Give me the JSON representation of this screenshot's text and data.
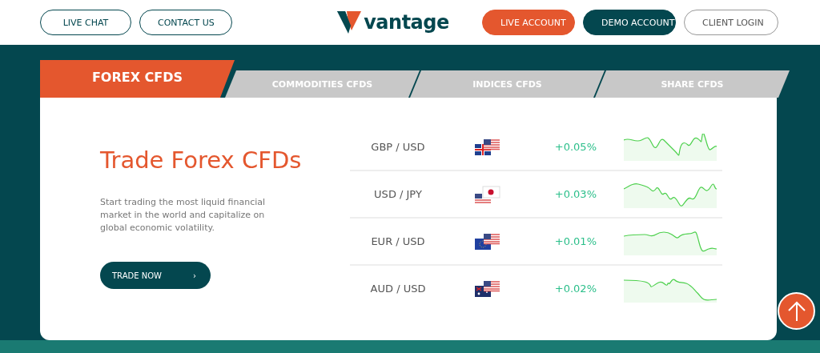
{
  "header": {
    "left_buttons": [
      "LIVE CHAT",
      "CONTACT US"
    ],
    "logo": "vantage",
    "right_buttons": [
      {
        "label": "LIVE ACCOUNT",
        "kind": "primary"
      },
      {
        "label": "DEMO ACCOUNT",
        "kind": "dark"
      },
      {
        "label": "CLIENT LOGIN",
        "kind": "outline"
      }
    ]
  },
  "tabs": [
    {
      "label": "FOREX CFDS",
      "selected": true
    },
    {
      "label": "COMMODITIES CFDS",
      "selected": false
    },
    {
      "label": "INDICES CFDS",
      "selected": false
    },
    {
      "label": "SHARE CFDS",
      "selected": false
    }
  ],
  "hero": {
    "title": "Trade Forex CFDs",
    "text": "Start trading the most liquid financial market in the world and capitalize on global economic volatility.",
    "button": "TRADE NOW",
    "button_icon": "›"
  },
  "rates": [
    {
      "pair": "GBP / USD",
      "change": "+0.05%"
    },
    {
      "pair": "USD / JPY",
      "change": "+0.03%"
    },
    {
      "pair": "EUR / USD",
      "change": "+0.01%"
    },
    {
      "pair": "AUD / USD",
      "change": "+0.02%"
    }
  ]
}
